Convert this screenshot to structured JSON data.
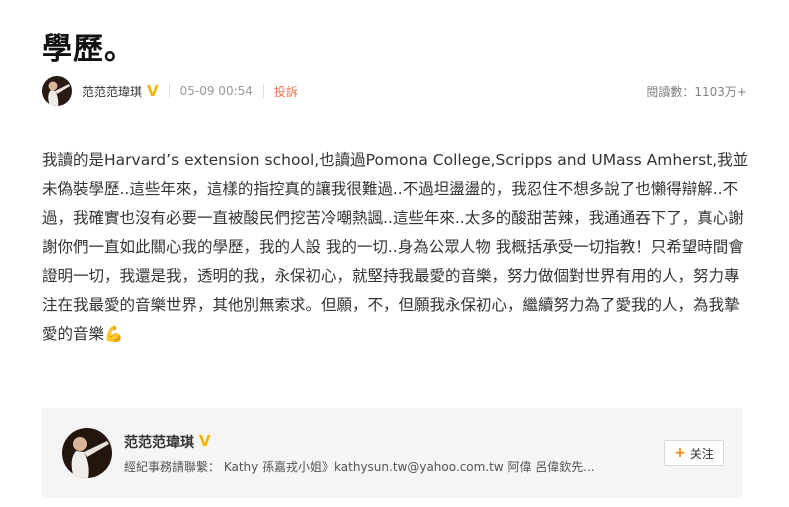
{
  "article": {
    "title": "學歷。",
    "author": "范范范瑋琪",
    "time": "05-09 00:54",
    "report_label": "投訴",
    "read_count": "閱讀數：1103万+"
  },
  "content": {
    "text": "我讀的是Harvard’s extension school,也讀過Pomona College,Scripps and UMass Amherst,我並未偽裝學歷..這些年來，這樣的指控真的讓我很難過..不過坦盪盪的，我忍住不想多說了也懶得辯解..不過，我確實也沒有必要一直被酸民們挖苦冷嘲熱諷..這些年來..太多的酸甜苦辣，我通通吞下了，真心謝謝你們一直如此關心我的學歷，我的人設 我的一切..身為公眾人物 我概括承受一切指教！只希望時間會證明一切，我還是我，透明的我，永保初心，就堅持我最愛的音樂，努力做個對世界有用的人，努力專注在我最愛的音樂世界，其他別無索求。但願，不，但願我永保初心，繼續努力為了愛我的人，為我摯愛的音樂💪"
  },
  "profile_card": {
    "name": "范范范瑋琪",
    "description": "經紀事務請聯繫： Kathy 孫嘉戎小姐》kathysun.tw@yahoo.com.tw 阿偉 呂偉欽先...",
    "follow_label": "关注"
  },
  "colors": {
    "verified_badge": "#f5b400",
    "report_link": "#eb7350",
    "follow_plus": "#ff8200",
    "card_bg": "#f5f5f6"
  }
}
